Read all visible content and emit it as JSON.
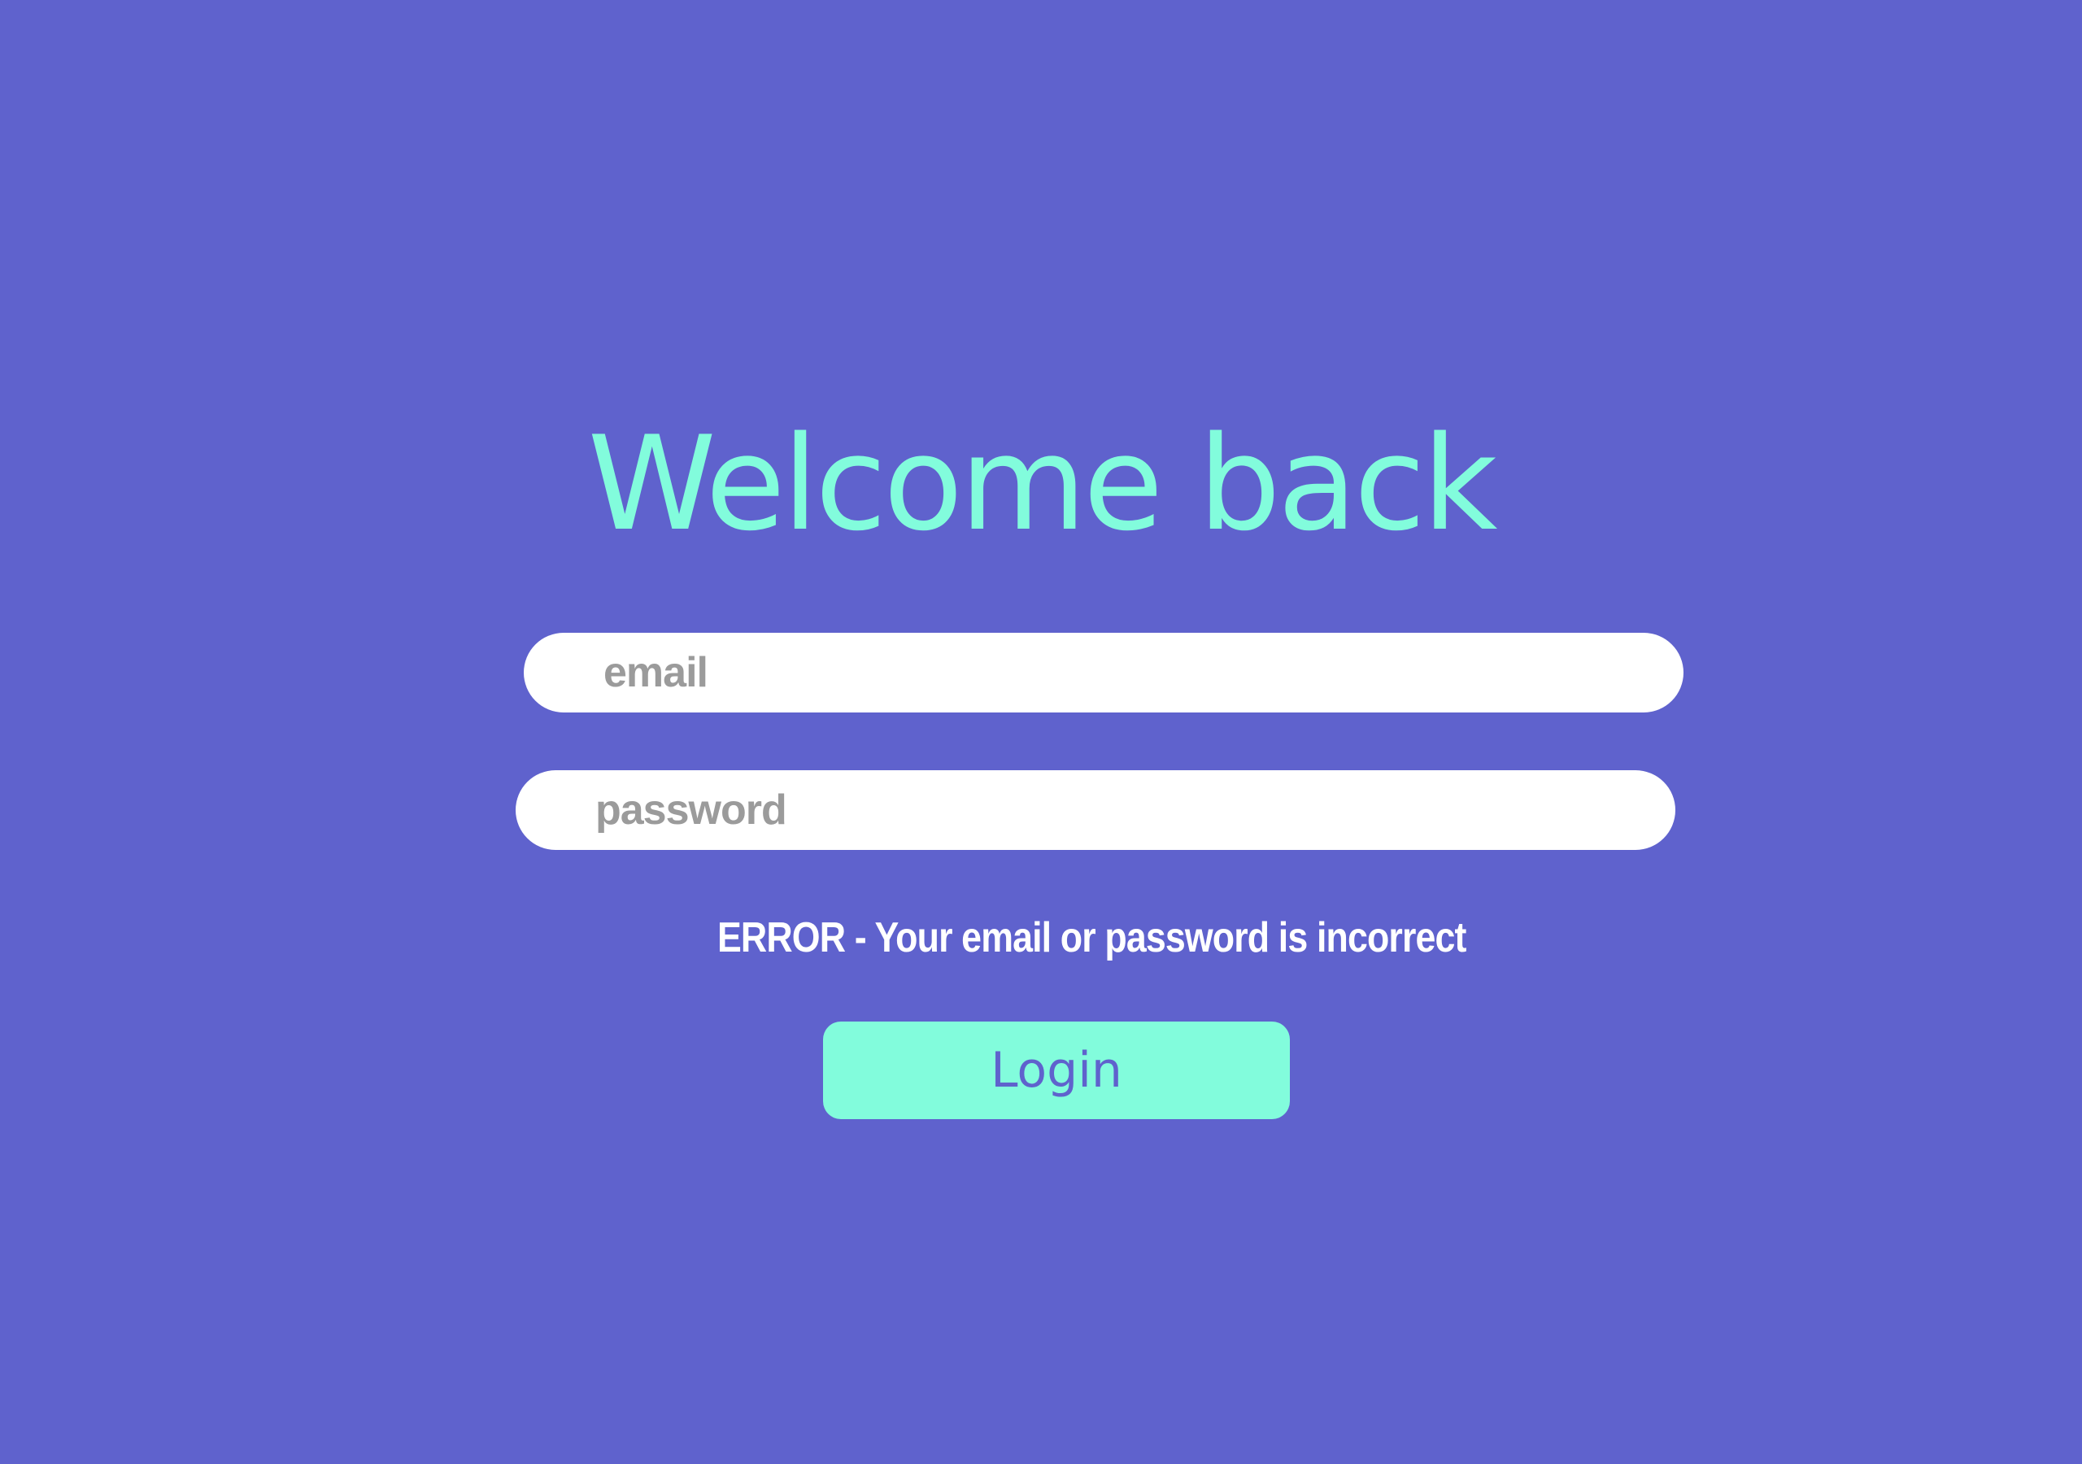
{
  "app": {
    "background_color": "#5f62cd",
    "accent_color": "#82fcdc"
  },
  "login_form": {
    "title": "Welcome back",
    "email": {
      "placeholder": "email",
      "value": ""
    },
    "password": {
      "placeholder": "password",
      "value": ""
    },
    "error_message": "ERROR - Your email or password is incorrect",
    "login_label": "Login"
  }
}
